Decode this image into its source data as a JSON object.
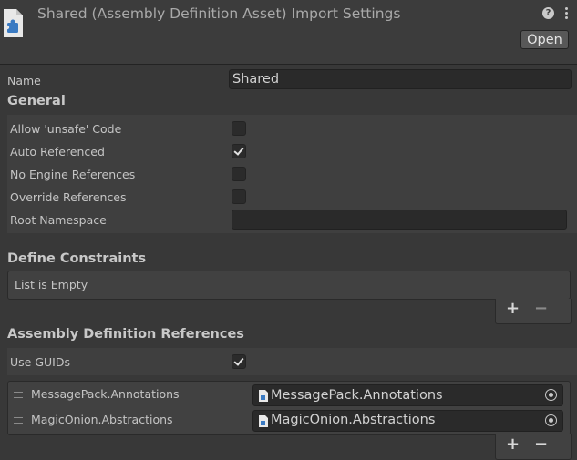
{
  "header": {
    "title": "Shared (Assembly Definition Asset) Import Settings",
    "help_glyph": "?",
    "open_label": "Open"
  },
  "name_row": {
    "label": "Name",
    "value": "Shared"
  },
  "general": {
    "title": "General",
    "toggles": [
      {
        "label": "Allow 'unsafe' Code",
        "checked": false
      },
      {
        "label": "Auto Referenced",
        "checked": true
      },
      {
        "label": "No Engine References",
        "checked": false
      },
      {
        "label": "Override References",
        "checked": false
      }
    ],
    "root_namespace": {
      "label": "Root Namespace",
      "value": ""
    }
  },
  "define_constraints": {
    "title": "Define Constraints",
    "empty_text": "List is Empty",
    "add": "+",
    "remove": "−"
  },
  "assembly_refs": {
    "title": "Assembly Definition References",
    "use_guids": {
      "label": "Use GUIDs",
      "checked": true
    },
    "items": [
      {
        "label": "MessagePack.Annotations",
        "value": "MessagePack.Annotations"
      },
      {
        "label": "MagicOnion.Abstractions",
        "value": "MagicOnion.Abstractions"
      }
    ],
    "add": "+",
    "remove": "−"
  },
  "icons": [
    "assembly-definition-icon",
    "help-icon",
    "kebab-menu-icon",
    "checkmark-icon",
    "drag-handle-icon",
    "asset-file-icon",
    "object-picker-icon"
  ]
}
